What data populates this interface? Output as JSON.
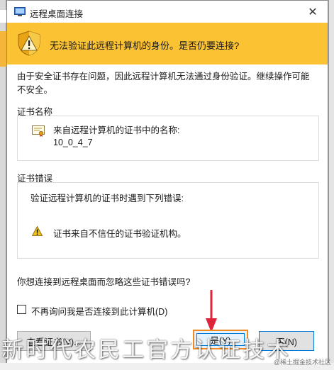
{
  "window": {
    "title": "远程桌面连接",
    "close_glyph": "✕"
  },
  "banner": {
    "message": "无法验证此远程计算机的身份。是否仍要连接?",
    "icon": "shield-warning-icon"
  },
  "description": "由于安全证书存在问题，因此远程计算机无法通过身份验证。继续操作可能不安全。",
  "cert_name_section": {
    "title": "证书名称",
    "label": "来自远程计算机的证书中的名称:",
    "value": "10_0_4_7"
  },
  "cert_error_section": {
    "title": "证书错误",
    "intro": "验证远程计算机的证书时遇到下列错误:",
    "error": "证书来自不信任的证书验证机构。"
  },
  "question": "你想连接到远程桌面而忽略这些证书错误吗?",
  "checkbox": {
    "label": "不再询问我是否连接到此计算机(D)",
    "checked": false
  },
  "buttons": {
    "view_cert": "查看证书(V)...",
    "yes": "是(Y)",
    "no": "否(N)"
  },
  "overlay": {
    "watermark": "新时代农民工官方认证技术",
    "watermark_small": "@稀土掘金技术社区"
  },
  "colors": {
    "banner": "#fbc233",
    "highlight": "#f08a24",
    "arrow": "#e0243a",
    "focus": "#0078d7"
  }
}
